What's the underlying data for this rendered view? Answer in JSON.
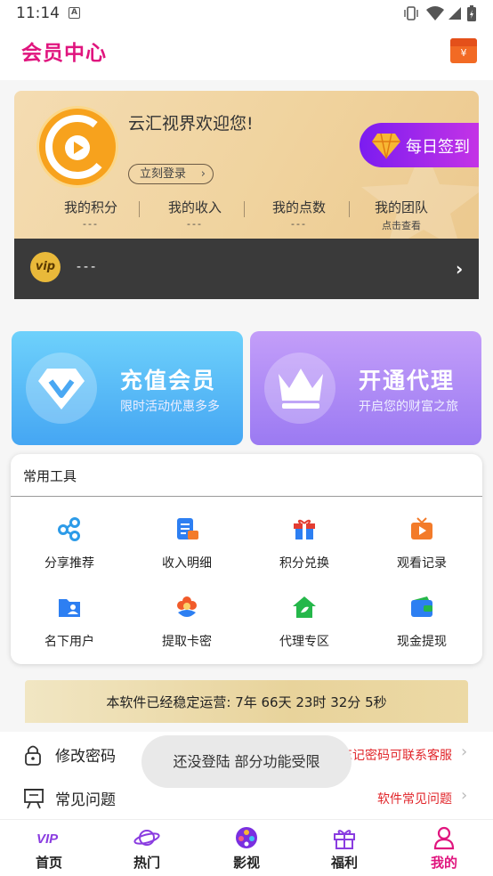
{
  "status": {
    "time": "11:14",
    "a_icon": "A"
  },
  "header": {
    "title": "会员中心",
    "redpacket_glyph": "¥"
  },
  "profile": {
    "welcome": "云汇视界欢迎您!",
    "login_label": "立刻登录",
    "checkin_label": "每日签到",
    "stats": [
      {
        "label": "我的积分",
        "value": "---"
      },
      {
        "label": "我的收入",
        "value": "---"
      },
      {
        "label": "我的点数",
        "value": "---"
      },
      {
        "label": "我的团队",
        "value": "点击查看"
      }
    ],
    "vip_badge": "vip",
    "vip_value": "---"
  },
  "promos": [
    {
      "title": "充值会员",
      "subtitle": "限时活动优惠多多"
    },
    {
      "title": "开通代理",
      "subtitle": "开启您的财富之旅"
    }
  ],
  "tools": {
    "title": "常用工具",
    "items": [
      {
        "label": "分享推荐",
        "icon": "share-icon"
      },
      {
        "label": "收入明细",
        "icon": "bill-icon"
      },
      {
        "label": "积分兑换",
        "icon": "gift-icon"
      },
      {
        "label": "观看记录",
        "icon": "tv-icon"
      },
      {
        "label": "名下用户",
        "icon": "user-folder-icon"
      },
      {
        "label": "提取卡密",
        "icon": "flower-icon"
      },
      {
        "label": "代理专区",
        "icon": "house-icon"
      },
      {
        "label": "现金提现",
        "icon": "wallet-icon"
      }
    ]
  },
  "runtime": {
    "text": "本软件已经稳定运营: 7年 66天 23时 32分 5秒"
  },
  "list": [
    {
      "label": "修改密码",
      "hint": "忘记密码可联系客服",
      "icon": "lock-icon"
    },
    {
      "label": "常见问题",
      "hint": "软件常见问题",
      "icon": "easel-icon"
    }
  ],
  "toast": "还没登陆 部分功能受限",
  "nav": [
    {
      "label": "首页",
      "icon": "vip-text-icon"
    },
    {
      "label": "热门",
      "icon": "planet-icon"
    },
    {
      "label": "影视",
      "icon": "film-reel-icon"
    },
    {
      "label": "福利",
      "icon": "gift-box-icon"
    },
    {
      "label": "我的",
      "icon": "person-icon"
    }
  ],
  "colors": {
    "brand": "#e0157e",
    "hint_red": "#e1252a",
    "recharge_blue": "#45a6f3",
    "agent_purple": "#9b7af2"
  }
}
